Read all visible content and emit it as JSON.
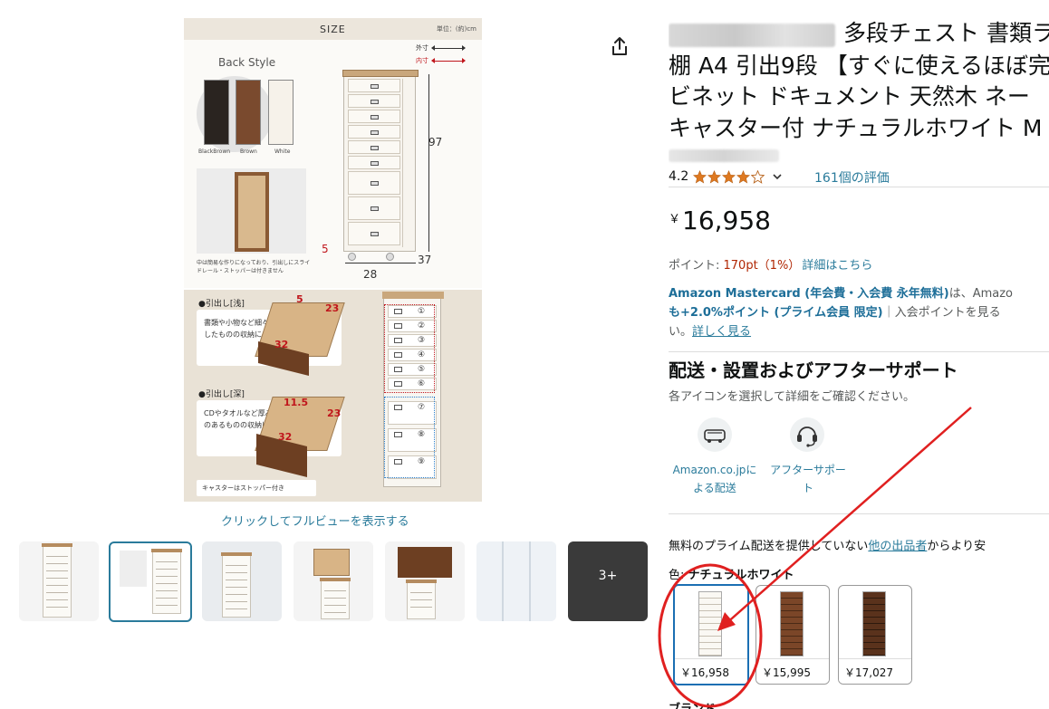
{
  "main_image": {
    "size_title": "SIZE",
    "unit_note": "単位：(約)cm",
    "legend_outer": "外寸",
    "legend_inner": "内寸",
    "back_style_title": "Back Style",
    "color_labels": [
      "BlackBrown",
      "Brown",
      "White"
    ],
    "back_note": "中は簡易な作りになっており、引出しにスライドレール・ストッパーは付きません",
    "dim_height": "97",
    "dim_width": "28",
    "dim_depth": "37",
    "dim_caster": "5",
    "shallow_title": "●引出し[浅]",
    "shallow_text": "書類や小物など細々したものの収納に",
    "shallow_dims": [
      "5",
      "23",
      "32"
    ],
    "deep_title": "●引出し[深]",
    "deep_text": "CDやタオルなど厚みのあるものの収納に",
    "deep_dims": [
      "11.5",
      "23",
      "32"
    ],
    "drawer_numbers": [
      "①",
      "②",
      "③",
      "④",
      "⑤",
      "⑥",
      "⑦",
      "⑧",
      "⑨"
    ],
    "caster_note": "キャスターはストッパー付き"
  },
  "fullview_link": "クリックしてフルビューを表示する",
  "thumbnails": {
    "count_visible": 7,
    "selected_index": 1,
    "more_label": "3+"
  },
  "product": {
    "title_line1": "多段チェスト 書類ラ",
    "title_line2": "棚 A4 引出9段 【すぐに使えるほぼ完",
    "title_line3": "ビネット ドキュメント 天然木 ネー",
    "title_line4": "キャスター付 ナチュラルホワイト M",
    "rating": "4.2",
    "review_count": "161個の評価",
    "price_symbol": "￥",
    "price": "16,958",
    "points_label": "ポイント: ",
    "points_value": "170pt（1%）",
    "points_link": "詳細はこちら",
    "card_bold1": "Amazon Mastercard (年会費・入会費 永年無料)",
    "card_text1": "は、Amazo",
    "card_bold2": "も+2.0%ポイント (プライム会員 限定)",
    "card_text2": "｜入会ポイントを見る",
    "card_text3": "い。",
    "card_link": "詳しく見る",
    "delivery_title": "配送・設置およびアフターサポート",
    "delivery_sub": "各アイコンを選択して詳細をご確認ください。",
    "service1_line1": "Amazon.co.jpに",
    "service1_line2": "よる配送",
    "service2_line1": "アフターサポー",
    "service2_line2": "ト",
    "other_prefix": "無料のプライム配送を提供していない",
    "other_link": "他の出品者",
    "other_suffix": "からより安",
    "color_label": "色: ",
    "color_value": "ナチュラルホワイト",
    "swatches": [
      {
        "price": "￥16,958",
        "color": "white"
      },
      {
        "price": "￥15,995",
        "color": "brown"
      },
      {
        "price": "￥17,027",
        "color": "brown"
      }
    ],
    "bottom_cut": "ブランド"
  },
  "colors": {
    "link": "#2a7b9b",
    "price_red": "#b12704",
    "selected_border": "#1b6fb3",
    "annotation_red": "#e02020"
  }
}
